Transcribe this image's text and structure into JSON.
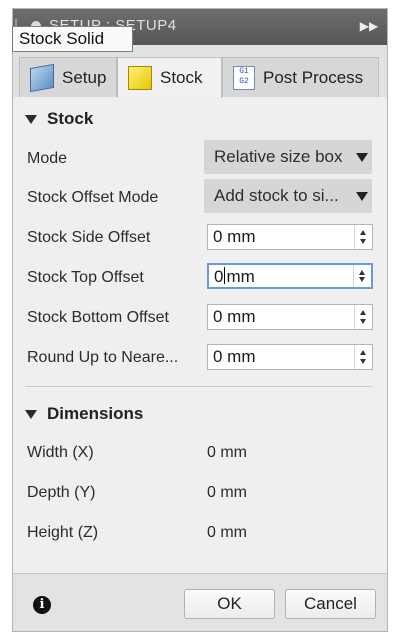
{
  "window": {
    "title": "SETUP : SETUP4",
    "expand_icon": "double-arrow-right-icon"
  },
  "tooltip": "Stock Solid",
  "tabs": [
    {
      "label": "Setup",
      "icon": "setup-icon",
      "active": false
    },
    {
      "label": "Stock",
      "icon": "stock-box-icon",
      "active": true
    },
    {
      "label": "Post Process",
      "icon": "g-code-icon",
      "active": false,
      "icon_text": [
        "G1",
        "G2"
      ]
    }
  ],
  "stock_section": {
    "title": "Stock",
    "mode": {
      "label": "Mode",
      "value": "Relative size box"
    },
    "offset_mode": {
      "label": "Stock Offset Mode",
      "value": "Add stock to si..."
    },
    "side_offset": {
      "label": "Stock Side Offset",
      "value": "0 mm"
    },
    "top_offset": {
      "label": "Stock Top Offset",
      "value": "0",
      "value_suffix": "mm"
    },
    "bottom_offset": {
      "label": "Stock Bottom Offset",
      "value": "0 mm"
    },
    "round_up": {
      "label": "Round Up to Neare...",
      "value": "0 mm"
    }
  },
  "dimensions_section": {
    "title": "Dimensions",
    "width": {
      "label": "Width (X)",
      "value": "0 mm"
    },
    "depth": {
      "label": "Depth (Y)",
      "value": "0 mm"
    },
    "height": {
      "label": "Height (Z)",
      "value": "0 mm"
    }
  },
  "footer": {
    "ok_label": "OK",
    "cancel_label": "Cancel",
    "info_icon": "info-icon"
  },
  "colors": {
    "accent_focus": "#6a99d8",
    "panel_bg": "#efefef",
    "titlebar_bg": "#5e5e5e"
  }
}
